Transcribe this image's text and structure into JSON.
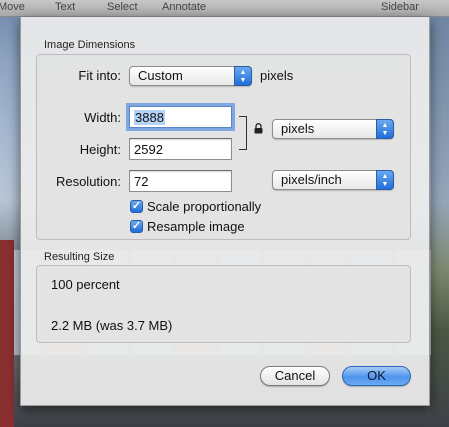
{
  "toolbar": {
    "items": [
      "Move",
      "Text",
      "Select",
      "Annotate",
      "Sidebar"
    ]
  },
  "dialog": {
    "dimensions_title": "Image Dimensions",
    "fit_into": {
      "label": "Fit into:",
      "value": "Custom",
      "suffix": "pixels"
    },
    "width": {
      "label": "Width:",
      "value": "3888"
    },
    "height": {
      "label": "Height:",
      "value": "2592"
    },
    "unit_popup": "pixels",
    "resolution": {
      "label": "Resolution:",
      "value": "72",
      "unit": "pixels/inch"
    },
    "scale_proportionally": {
      "label": "Scale proportionally",
      "checked": true
    },
    "resample_image": {
      "label": "Resample image",
      "checked": true
    },
    "resulting_title": "Resulting Size",
    "percent": "100 percent",
    "size": "2.2 MB (was 3.7 MB)",
    "cancel_label": "Cancel",
    "ok_label": "OK"
  },
  "colors": {
    "accent": "#1f6fd9",
    "focus_ring": "#7fa8e0"
  }
}
